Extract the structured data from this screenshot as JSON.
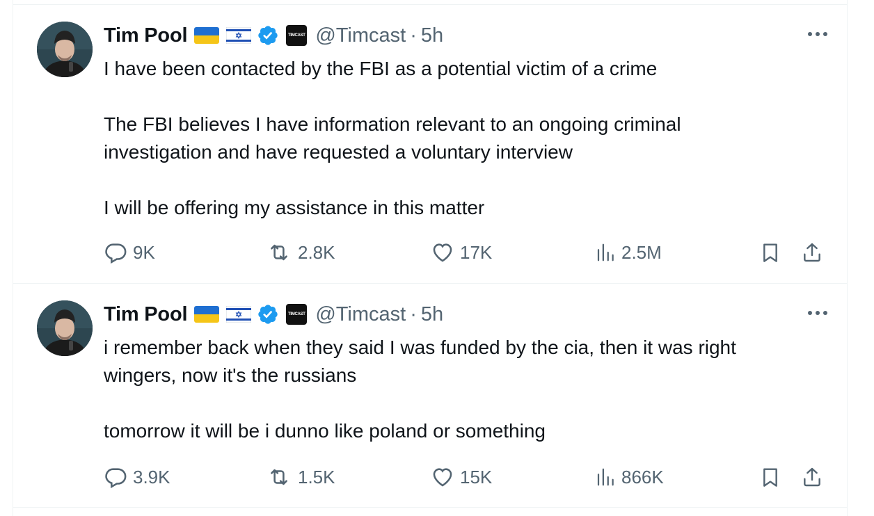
{
  "tweets": [
    {
      "author_name": "Tim Pool",
      "handle": "@Timcast",
      "separator": "·",
      "time": "5h",
      "affiliate_label": "TIMCAST",
      "lines": [
        "I have been contacted by the FBI as a potential victim of a crime",
        "",
        "The FBI believes I have information relevant to an ongoing criminal",
        "investigation and have requested a voluntary interview",
        "",
        "I will be offering my assistance in this matter"
      ],
      "replies": "9K",
      "retweets": "2.8K",
      "likes": "17K",
      "views": "2.5M"
    },
    {
      "author_name": "Tim Pool",
      "handle": "@Timcast",
      "separator": "·",
      "time": "5h",
      "affiliate_label": "TIMCAST",
      "lines": [
        "i remember back when they said I was funded by the cia, then it was right",
        "wingers, now it's the russians",
        "",
        "tomorrow it will be i dunno like poland or something"
      ],
      "replies": "3.9K",
      "retweets": "1.5K",
      "likes": "15K",
      "views": "866K"
    }
  ],
  "icons": {
    "reply": "reply-icon",
    "retweet": "retweet-icon",
    "like": "heart-icon",
    "views": "views-icon",
    "bookmark": "bookmark-icon",
    "share": "share-icon",
    "more": "more-icon",
    "verified": "verified-badge-icon"
  },
  "colors": {
    "text": "#0f1419",
    "secondary": "#536471",
    "verified": "#1d9bf0",
    "divider": "#eff3f4"
  }
}
